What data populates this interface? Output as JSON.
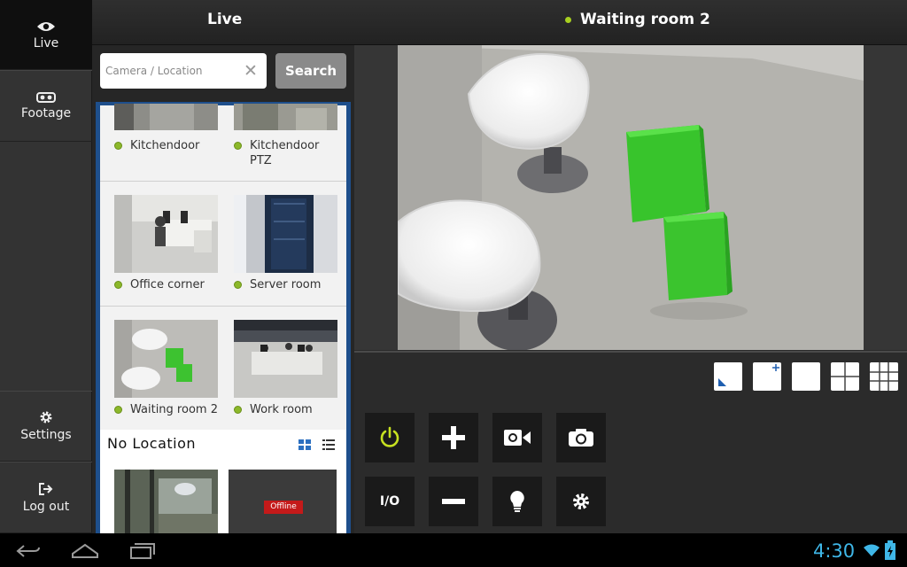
{
  "sidebar": {
    "live_label": "Live",
    "footage_label": "Footage",
    "settings_label": "Settings",
    "logout_label": "Log out"
  },
  "header": {
    "section_title": "Live",
    "camera_title": "Waiting room 2",
    "status_color": "#a8d020"
  },
  "search": {
    "placeholder": "Camera / Location",
    "button_label": "Search"
  },
  "cameras": [
    {
      "name": "Kitchendoor",
      "online": true
    },
    {
      "name": "Kitchendoor PTZ",
      "online": true
    },
    {
      "name": "Office corner",
      "online": true
    },
    {
      "name": "Server room",
      "online": true
    },
    {
      "name": "Waiting room 2",
      "online": true
    },
    {
      "name": "Work room",
      "online": true
    }
  ],
  "no_location": {
    "title": "No Location",
    "offline_label": "Offline"
  },
  "controls": {
    "io_label": "I/O",
    "power_color": "#c6e020"
  },
  "system": {
    "clock": "4:30",
    "clock_color": "#3fb7e8"
  }
}
